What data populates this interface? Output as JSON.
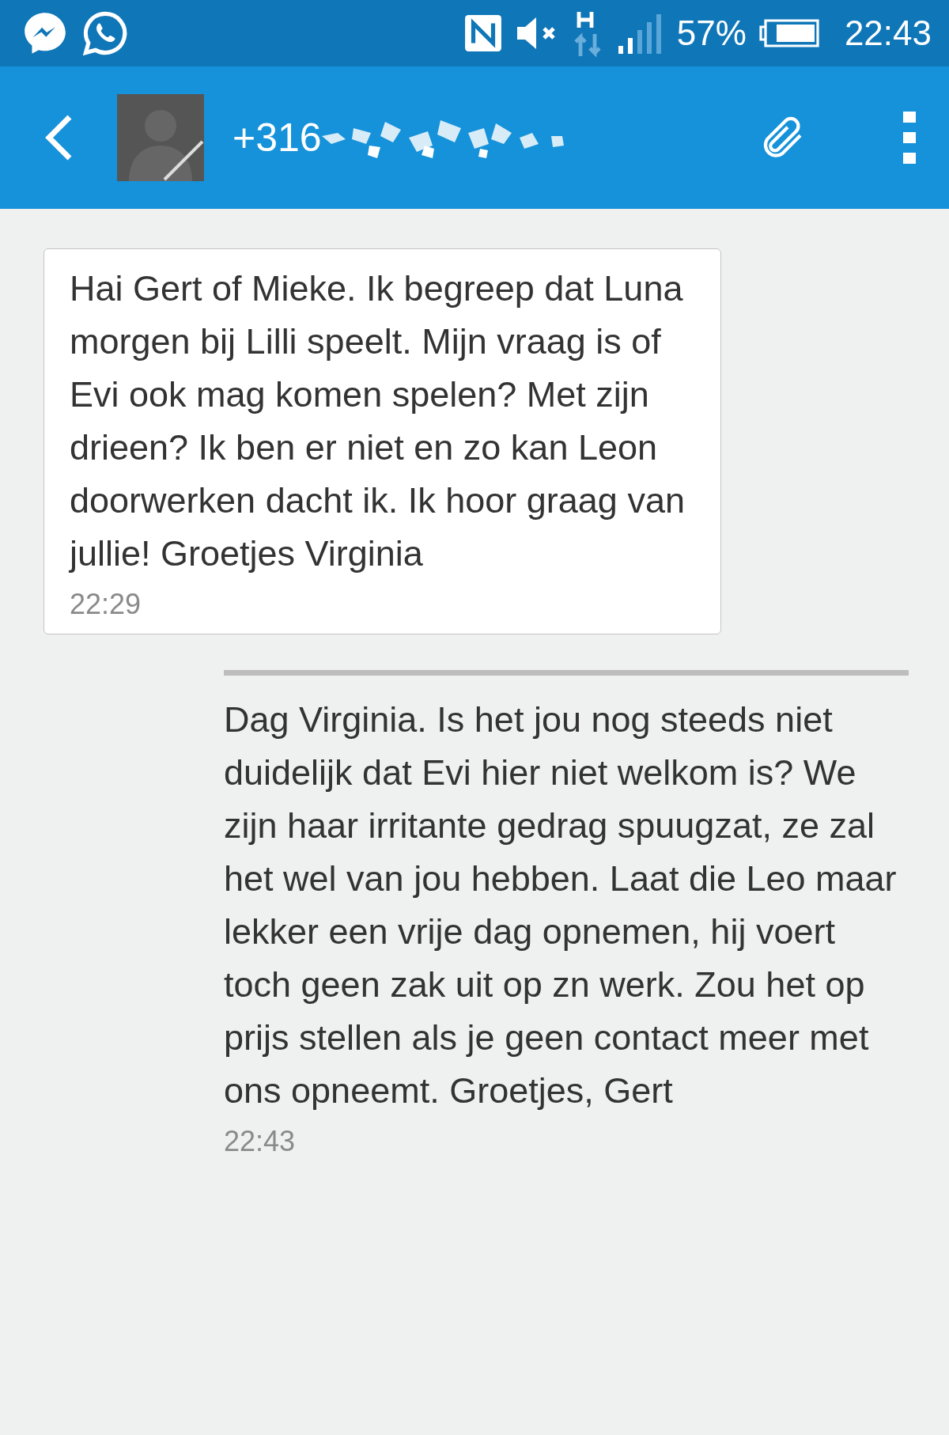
{
  "status_bar": {
    "battery": "57%",
    "time": "22:43"
  },
  "header": {
    "contact": "+316"
  },
  "messages": [
    {
      "kind": "incoming",
      "text": "Hai Gert of Mieke. Ik begreep dat Luna morgen bij Lilli speelt. Mijn vraag is of Evi ook mag komen spelen? Met zijn drieen? Ik ben er niet en zo kan Leon doorwerken dacht ik. Ik hoor graag van jullie! Groetjes Virginia",
      "time": "22:29"
    },
    {
      "kind": "outgoing",
      "text": "Dag Virginia. Is het jou nog steeds niet duidelijk dat Evi hier niet welkom is? We zijn haar irritante gedrag spuugzat, ze zal het wel van jou hebben. Laat die Leo maar lekker een vrije dag opnemen, hij voert toch geen zak uit op zn werk. Zou het op prijs stellen als je geen contact meer met ons opneemt. Groetjes, Gert",
      "time": "22:43"
    }
  ]
}
